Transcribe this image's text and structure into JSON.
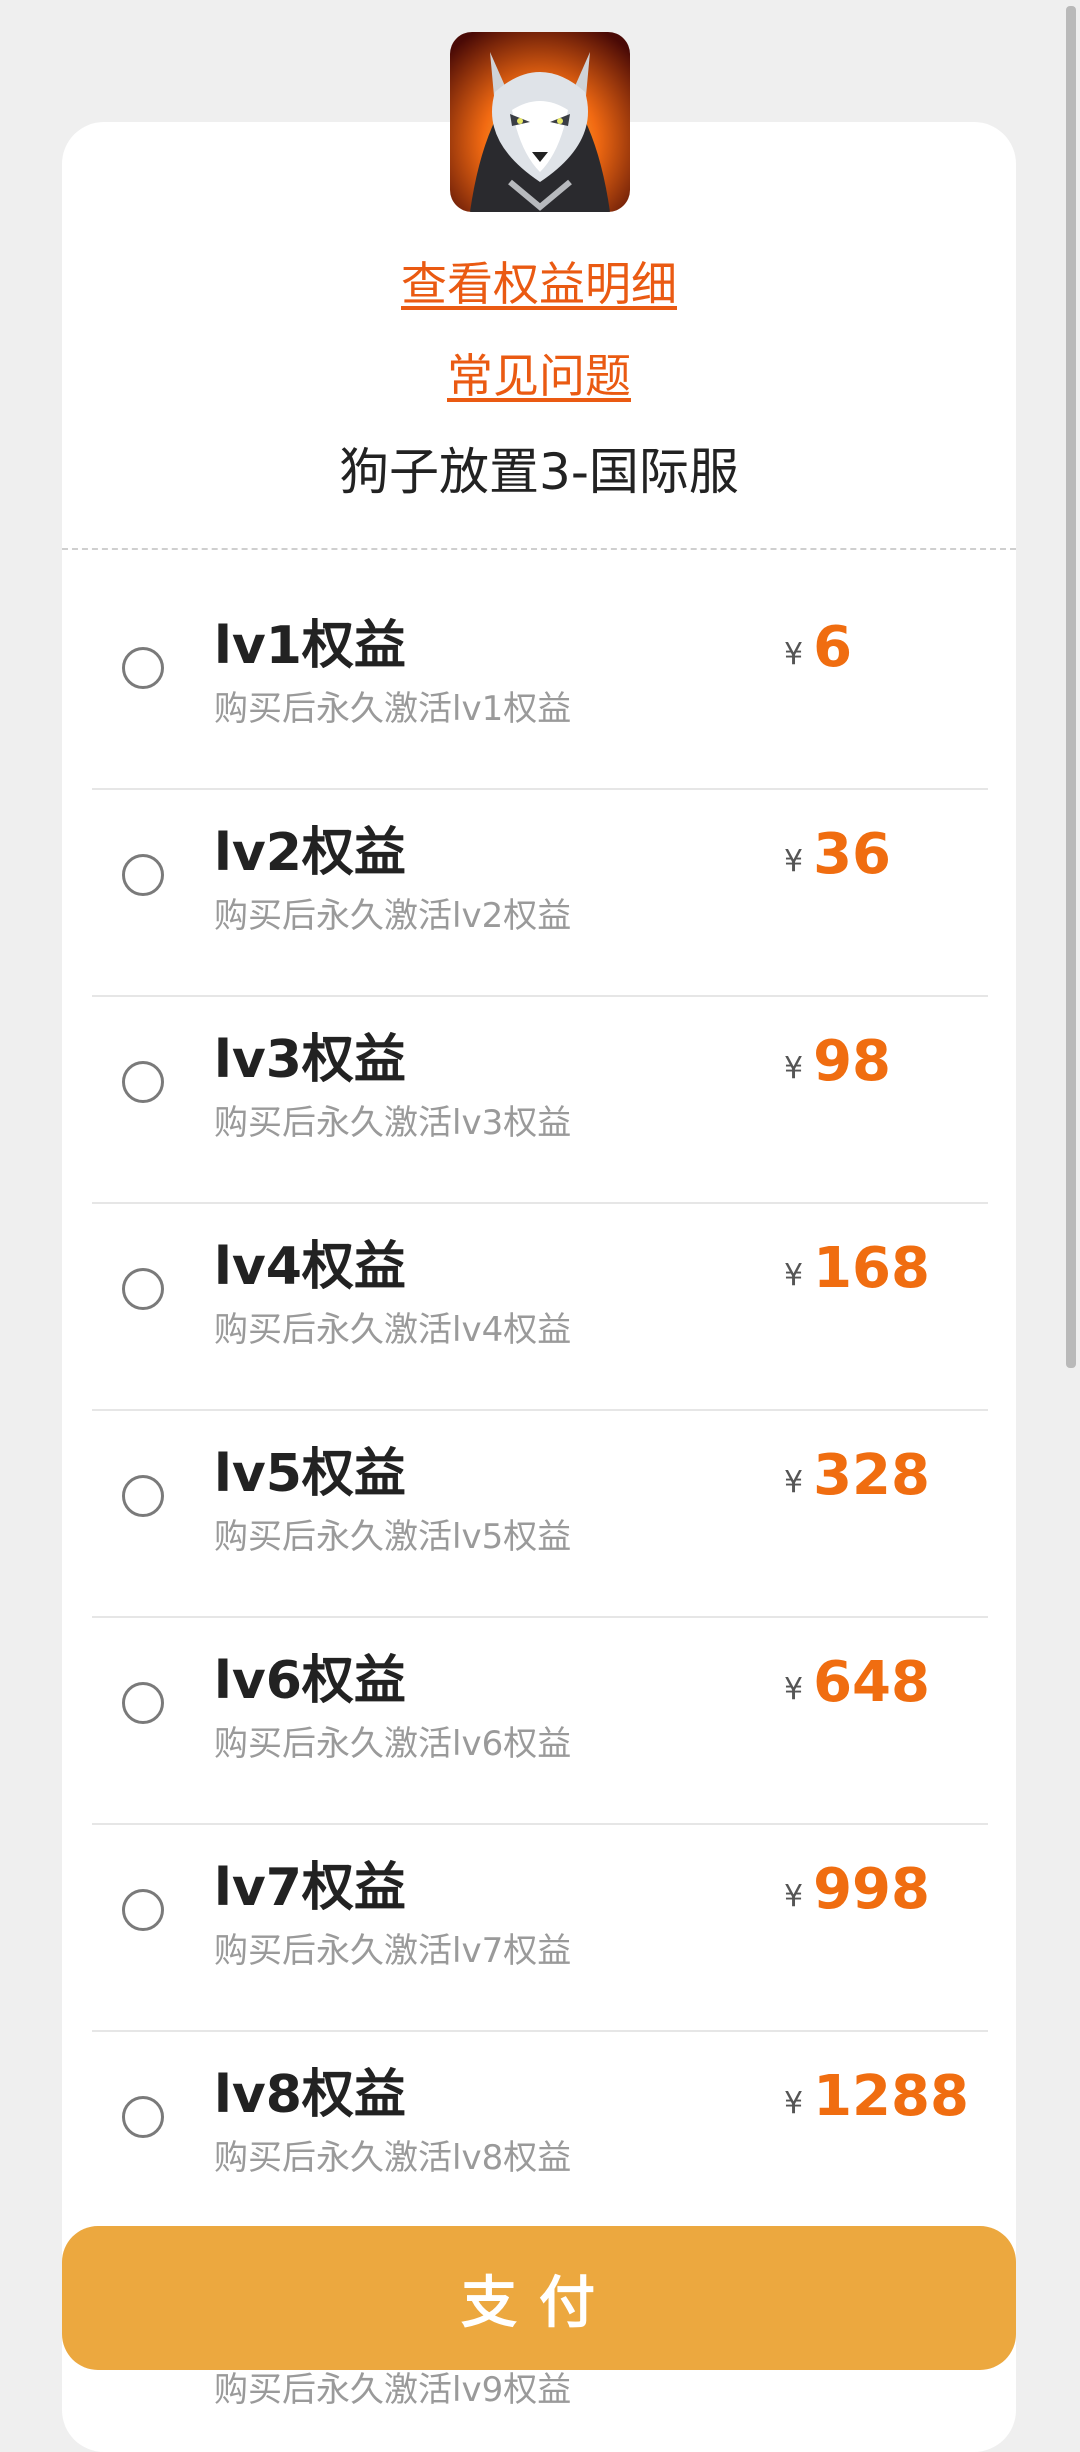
{
  "header": {
    "avatar_icon": "wolf-avatar-icon",
    "link_detail": "查看权益明细",
    "link_faq": "常见问题",
    "game_title": "狗子放置3-国际服"
  },
  "items": [
    {
      "title": "lv1权益",
      "desc": "购买后永久激活lv1权益",
      "currency": "¥",
      "price": "6"
    },
    {
      "title": "lv2权益",
      "desc": "购买后永久激活lv2权益",
      "currency": "¥",
      "price": "36"
    },
    {
      "title": "lv3权益",
      "desc": "购买后永久激活lv3权益",
      "currency": "¥",
      "price": "98"
    },
    {
      "title": "lv4权益",
      "desc": "购买后永久激活lv4权益",
      "currency": "¥",
      "price": "168"
    },
    {
      "title": "lv5权益",
      "desc": "购买后永久激活lv5权益",
      "currency": "¥",
      "price": "328"
    },
    {
      "title": "lv6权益",
      "desc": "购买后永久激活lv6权益",
      "currency": "¥",
      "price": "648"
    },
    {
      "title": "lv7权益",
      "desc": "购买后永久激活lv7权益",
      "currency": "¥",
      "price": "998"
    },
    {
      "title": "lv8权益",
      "desc": "购买后永久激活lv8权益",
      "currency": "¥",
      "price": "1288"
    }
  ],
  "peek_item": {
    "desc": "购买后永久激活lv9权益"
  },
  "pay_button": {
    "label": "支付"
  },
  "colors": {
    "accent": "#ea5a12",
    "price": "#f06d10",
    "pay": "#eca83f"
  }
}
